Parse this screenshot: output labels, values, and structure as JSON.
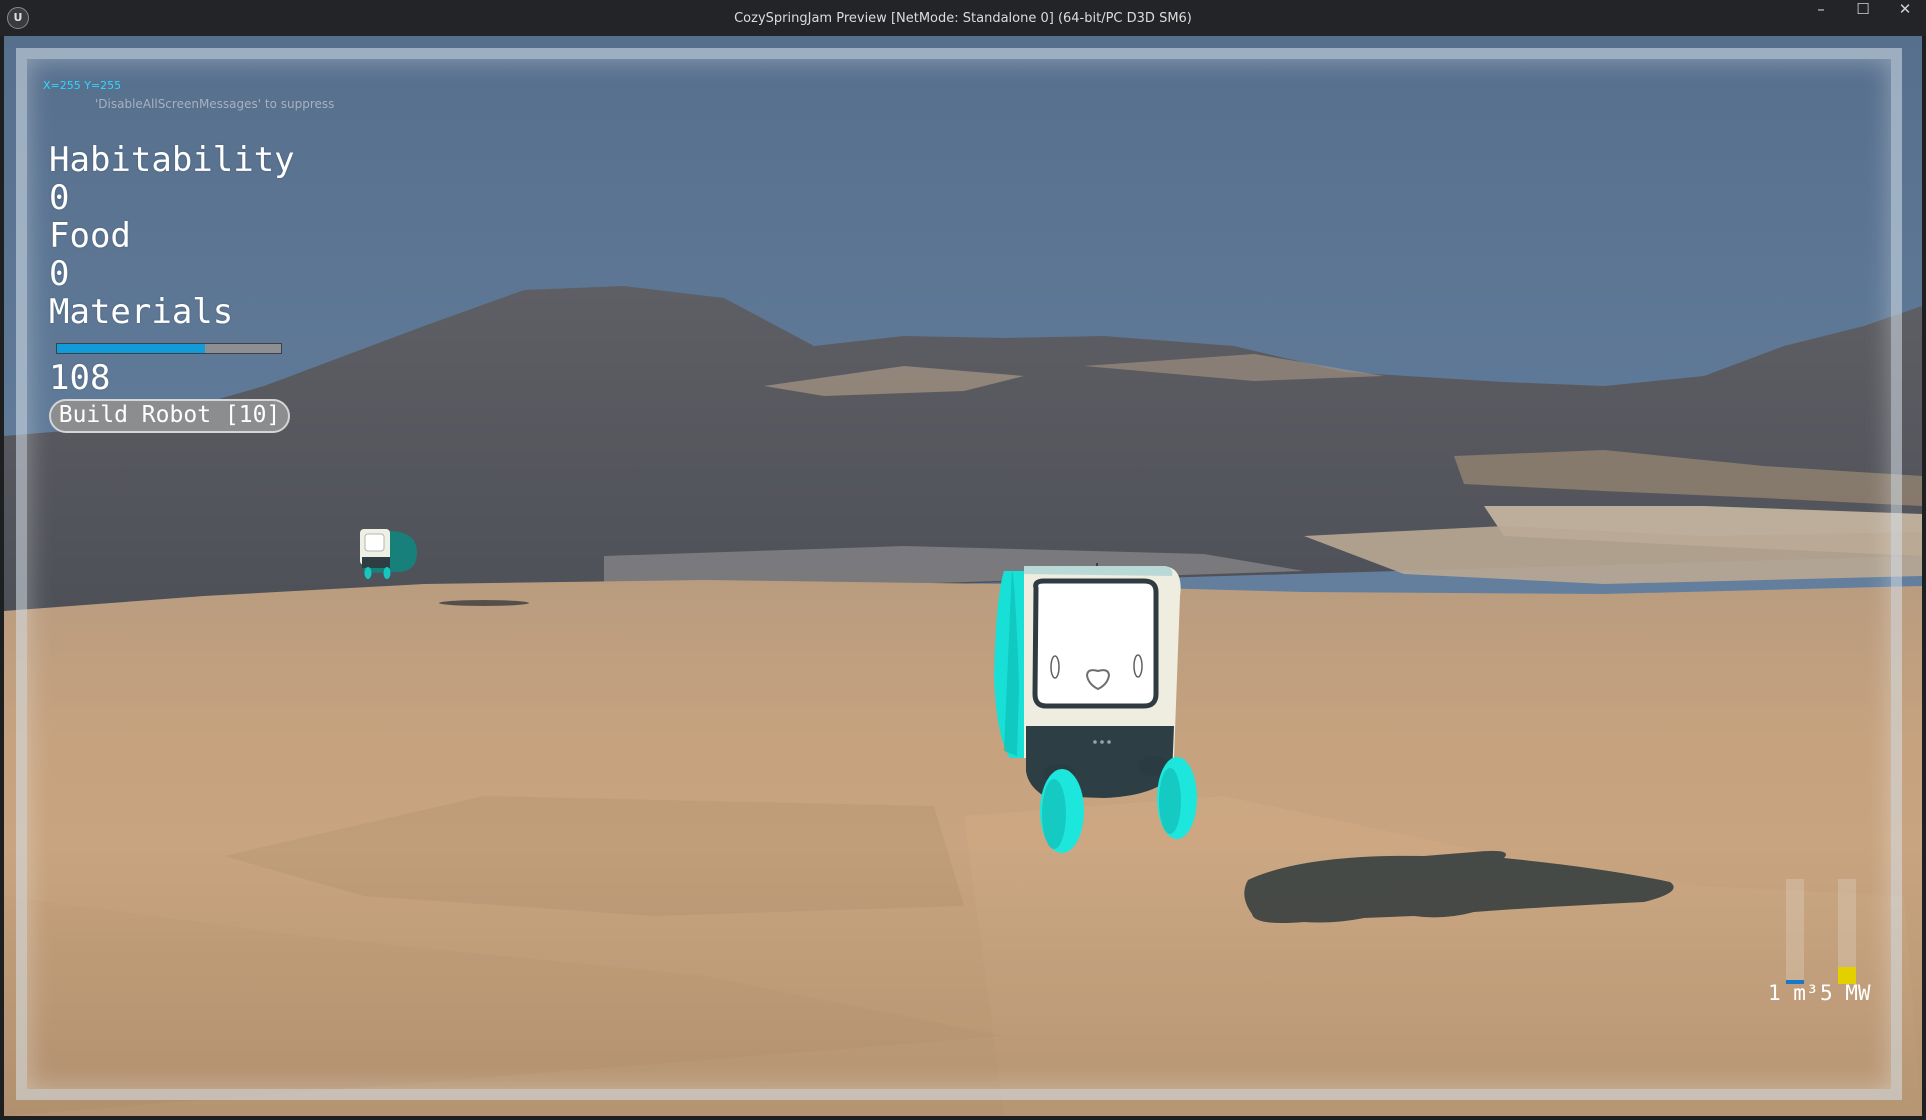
{
  "window": {
    "title": "CozySpringJam Preview [NetMode: Standalone 0]  (64-bit/PC D3D SM6)",
    "logo_icon": "unreal-logo-icon",
    "controls": [
      "minimize-icon",
      "maximize-icon",
      "close-icon"
    ]
  },
  "debug": {
    "coords": "X=255 Y=255",
    "suppress_msg": "'DisableAllScreenMessages' to suppress"
  },
  "hud": {
    "habitability_label": "Habitability",
    "habitability_value": "0",
    "food_label": "Food",
    "food_value": "0",
    "materials_label": "Materials",
    "materials_progress": 0.66,
    "materials_value": "108",
    "build_button": "Build Robot [10]"
  },
  "gauges": {
    "water_label": "1 m³",
    "water_level": 0.04,
    "water_color": "#1a78c8",
    "power_label": "5 MW",
    "power_level": 0.16,
    "power_color": "#e4cf00"
  },
  "colors": {
    "accent": "#129bd9",
    "robot_teal": "#1ce5dd",
    "sand": "#c9a57f",
    "sky": "#5b7795"
  }
}
